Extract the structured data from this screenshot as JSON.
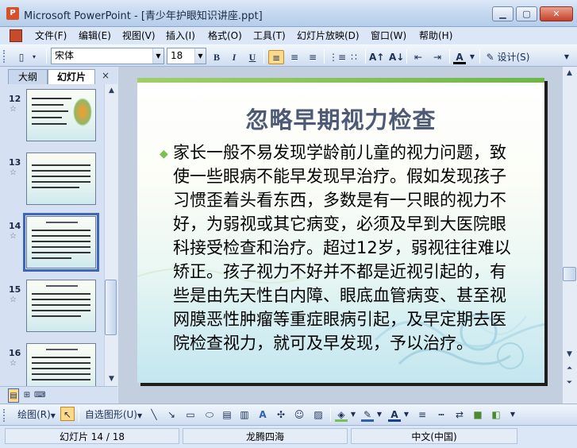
{
  "window": {
    "title": "Microsoft PowerPoint - [青少年护眼知识讲座.ppt]",
    "app_icon": "P",
    "controls": {
      "minimize": "▁",
      "maximize": "▢",
      "close": "✕"
    }
  },
  "menu": {
    "items": [
      "文件(F)",
      "编辑(E)",
      "视图(V)",
      "插入(I)",
      "格式(O)",
      "工具(T)",
      "幻灯片放映(D)",
      "窗口(W)",
      "帮助(H)"
    ]
  },
  "toolbar": {
    "font_name": "宋体",
    "font_size": "18",
    "bold": "B",
    "italic": "I",
    "underline": "U",
    "design_label": "设计(S)"
  },
  "panel": {
    "tab_outline": "大纲",
    "tab_slides": "幻灯片",
    "close": "×",
    "slides": [
      {
        "num": "12",
        "star": "☆"
      },
      {
        "num": "13",
        "star": "☆"
      },
      {
        "num": "14",
        "star": "☆"
      },
      {
        "num": "15",
        "star": "☆"
      },
      {
        "num": "16",
        "star": "☆"
      }
    ]
  },
  "slide": {
    "title": "忽略早期视力检查",
    "bullet": "◆",
    "body": "家长一般不易发现学龄前儿童的视力问题，致使一些眼病不能早发现早治疗。假如发现孩子习惯歪着头看东西，多数是有一只眼的视力不好，为弱视或其它病变，必须及早到大医院眼科接受检查和治疗。超过12岁，弱视往往难以矫正。孩子视力不好并不都是近视引起的，有些是由先天性白内障、眼底血管病变、甚至视网膜恶性肿瘤等重症眼病引起，及早定期去医院检查视力，就可及早发现，予以治疗。"
  },
  "drawbar": {
    "draw_label": "绘图(R)",
    "autoshape_label": "自选图形(U)"
  },
  "status": {
    "slide_info": "幻灯片 14 / 18",
    "template": "龙腾四海",
    "language": "中文(中国)"
  },
  "colors": {
    "title": "#4d5a75",
    "accent_bar": "#7cbf52",
    "selection": "#3f66b4"
  }
}
